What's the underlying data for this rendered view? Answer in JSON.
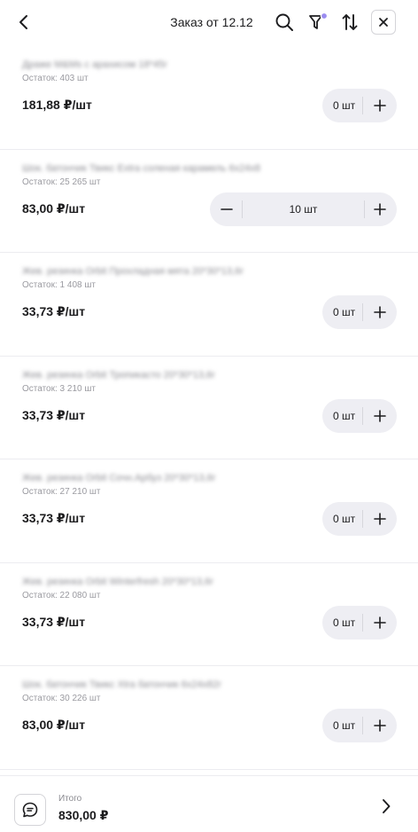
{
  "header": {
    "title": "Заказ от 12.12",
    "icons": [
      "back-arrow-icon",
      "search-icon",
      "filter-icon",
      "sort-icon",
      "close-icon"
    ],
    "filter_badge_color": "#9b8cf0"
  },
  "items": [
    {
      "name": "Драже M&Ms с арахисом 18*45г",
      "stock": "Остаток: 403 шт",
      "price": "181,88 ₽/шт",
      "qty": "0 шт",
      "expanded": false
    },
    {
      "name": "Шок. батончик Твикс Extra соленая карамель 6x24x8",
      "stock": "Остаток: 25 265 шт",
      "price": "83,00 ₽/шт",
      "qty": "10 шт",
      "expanded": true
    },
    {
      "name": "Жев. резинка Orbit Прохладная мята 20*30*13,6г",
      "stock": "Остаток: 1 408 шт",
      "price": "33,73 ₽/шт",
      "qty": "0 шт",
      "expanded": false
    },
    {
      "name": "Жев. резинка Orbit Тропикасто 20*30*13,6г",
      "stock": "Остаток: 3 210 шт",
      "price": "33,73 ₽/шт",
      "qty": "0 шт",
      "expanded": false
    },
    {
      "name": "Жев. резинка Orbit Сочн.Арбуз 20*30*13,6г",
      "stock": "Остаток: 27 210 шт",
      "price": "33,73 ₽/шт",
      "qty": "0 шт",
      "expanded": false
    },
    {
      "name": "Жев. резинка Orbit Winterfresh 20*30*13,6г",
      "stock": "Остаток: 22 080 шт",
      "price": "33,73 ₽/шт",
      "qty": "0 шт",
      "expanded": false
    },
    {
      "name": "Шок. батончик Твикс Xtra батончик 6x24x82г",
      "stock": "Остаток: 30 226 шт",
      "price": "83,00 ₽/шт",
      "qty": "0 шт",
      "expanded": false
    }
  ],
  "footer": {
    "total_label": "Итого",
    "total_value": "830,00 ₽"
  }
}
